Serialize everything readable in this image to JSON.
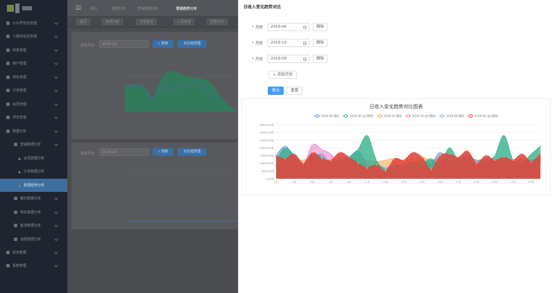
{
  "sidebar": {
    "items": [
      {
        "label": "公众号信息管理",
        "level": 0
      },
      {
        "label": "小程序信息管理",
        "level": 0
      },
      {
        "label": "商家管理",
        "level": 0
      },
      {
        "label": "用户管理",
        "level": 0
      },
      {
        "label": "停车管理",
        "level": 0
      },
      {
        "label": "订单管理",
        "level": 0
      },
      {
        "label": "会员管理",
        "level": 0
      },
      {
        "label": "评论管理",
        "level": 0
      },
      {
        "label": "数据分析",
        "level": 0
      },
      {
        "label": "营销数据分析",
        "level": 1
      },
      {
        "label": "会员数据分析",
        "level": 2
      },
      {
        "label": "订单数据分析",
        "level": 2
      },
      {
        "label": "数据趋势分析",
        "level": 2,
        "active": true
      },
      {
        "label": "餐饮数据分析",
        "level": 1
      },
      {
        "label": "停车数据分析",
        "level": 1
      },
      {
        "label": "客流数据分析",
        "level": 1
      },
      {
        "label": "消费数据分析",
        "level": 1
      },
      {
        "label": "财务数据",
        "level": 0
      },
      {
        "label": "系统管理",
        "level": 0
      }
    ]
  },
  "breadcrumb": [
    "首页",
    "数据分析",
    "营销数据分析",
    "数据趋势分析"
  ],
  "tabs": [
    "首页",
    "数据对账",
    "交易查询",
    "人员管理",
    "经营分析"
  ],
  "background": {
    "filter_label": "选择月份:",
    "filter_value": "2019-10",
    "search_label": "搜索",
    "compare_label": "对比趋势图"
  },
  "drawer": {
    "title": "日收入变化趋势对比",
    "month_label": "月份",
    "months": [
      "2019-06",
      "2019-10",
      "2019-08"
    ],
    "delete_label": "删除",
    "add_label": "添加月份",
    "submit_label": "提交",
    "reset_label": "重置"
  },
  "chart_data": {
    "type": "area",
    "title": "日收入变化趋势对比图表",
    "x": [
      "1日",
      "2日",
      "3日",
      "4日",
      "5日",
      "6日",
      "7日",
      "8日",
      "9日",
      "10日",
      "11日",
      "12日",
      "13日",
      "14日",
      "15日",
      "16日",
      "17日",
      "18日",
      "19日",
      "20日",
      "21日",
      "22日",
      "23日",
      "24日",
      "25日",
      "26日",
      "27日",
      "28日",
      "29日",
      "30日"
    ],
    "x_tick_labels": [
      "1日",
      "3日",
      "5日",
      "7日",
      "9日",
      "11日",
      "13日",
      "15日",
      "17日",
      "19日",
      "21日",
      "23日",
      "25日",
      "27日",
      "29日"
    ],
    "ylim": [
      0,
      35000
    ],
    "y_ticks": [
      "0.00元",
      "5000.00元",
      "10000.00元",
      "15000.00元",
      "20000.00元",
      "25000.00元",
      "30000.00元",
      "35000.00元"
    ],
    "series": [
      {
        "name": "2019-06 费用",
        "color": "#5a8fd8",
        "values": [
          15000,
          21000,
          14000,
          9000,
          13000,
          16000,
          10000,
          13000,
          14000,
          18000,
          9000,
          9000,
          7000,
          9000,
          8000,
          9000,
          12000,
          10000,
          17000,
          11000,
          13000,
          15000,
          12000,
          13000,
          12000,
          12000,
          10000,
          13000,
          12000,
          14000
        ]
      },
      {
        "name": "2019-06 支付费用",
        "color": "#36b28c",
        "values": [
          12000,
          20000,
          15000,
          8000,
          16000,
          14000,
          11000,
          12000,
          14000,
          19000,
          28000,
          12000,
          6000,
          8000,
          9000,
          11000,
          10000,
          13000,
          9000,
          20000,
          12000,
          14000,
          8000,
          11000,
          15000,
          28000,
          12000,
          10000,
          16000,
          21000
        ]
      },
      {
        "name": "2019-10 费用",
        "color": "#f5a04d",
        "values": [
          14000,
          14000,
          13000,
          12000,
          14000,
          13000,
          12000,
          14000,
          13000,
          13000,
          12000,
          11000,
          12000,
          13000,
          12000,
          13000,
          14000,
          12000,
          13000,
          12000,
          13000,
          14000,
          12000,
          13000,
          12000,
          13000,
          12000,
          13000,
          12000,
          13000
        ]
      },
      {
        "name": "2019-10 支付费用",
        "color": "#e87cc1",
        "values": [
          8000,
          12000,
          10000,
          9000,
          22000,
          19000,
          16000,
          10000,
          12000,
          11000,
          9000,
          6000,
          4000,
          5000,
          7000,
          6000,
          8000,
          7000,
          10000,
          9000,
          8000,
          11000,
          9000,
          8000,
          12000,
          10000,
          9000,
          11000,
          10000,
          12000
        ]
      },
      {
        "name": "2019-08 费用",
        "color": "#8fa8d8",
        "values": [
          9000,
          11000,
          8000,
          7000,
          9000,
          10000,
          8000,
          9000,
          8000,
          10000,
          7000,
          6000,
          5000,
          6000,
          7000,
          8000,
          7000,
          9000,
          8000,
          7000,
          9000,
          10000,
          8000,
          9000,
          8000,
          9000,
          8000,
          9000,
          10000,
          11000
        ]
      },
      {
        "name": "2019-08 支付费用",
        "color": "#e0463d",
        "values": [
          15000,
          13000,
          16000,
          10000,
          17000,
          13000,
          12000,
          17000,
          14000,
          10000,
          7000,
          9000,
          5000,
          13000,
          12000,
          17000,
          14000,
          6000,
          15000,
          16000,
          14000,
          18000,
          10000,
          15000,
          12000,
          14000,
          12000,
          16000,
          11000,
          16000
        ]
      }
    ],
    "legend_position": "top-center"
  }
}
